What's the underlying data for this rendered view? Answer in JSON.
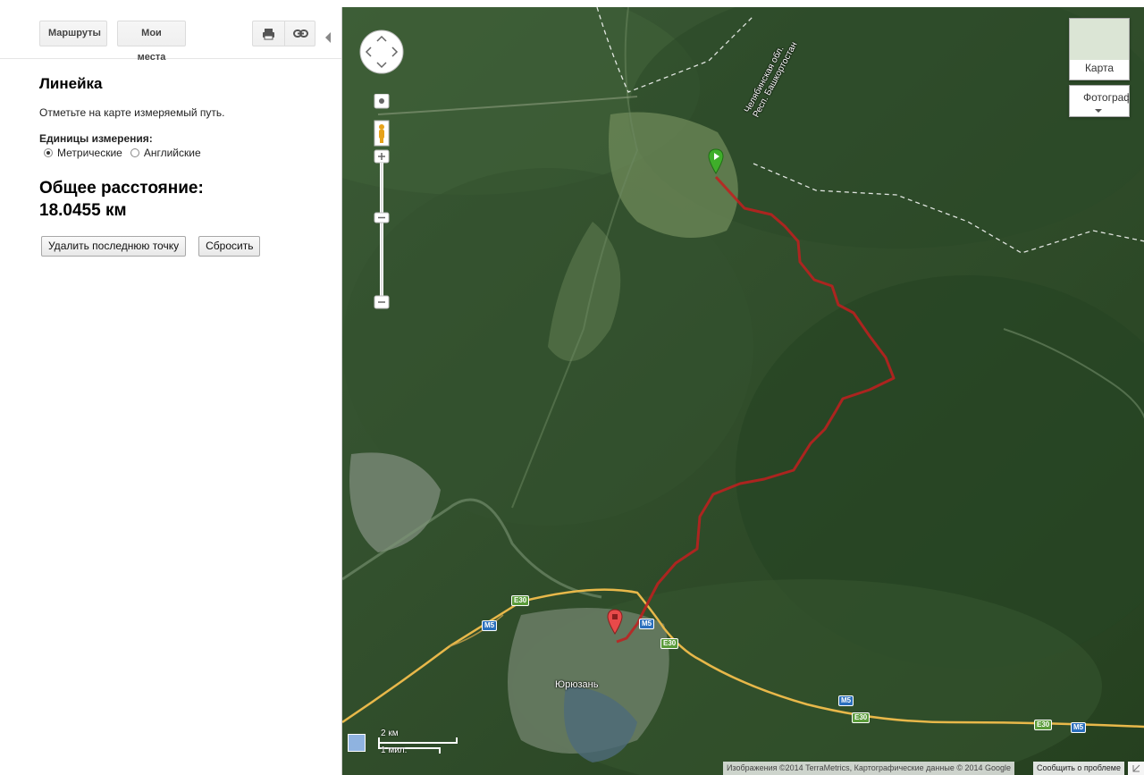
{
  "toolbar": {
    "routes_label": "Маршруты",
    "myplaces_label": "Мои места",
    "print_icon": "printer-icon",
    "link_icon": "link-icon",
    "collapse_icon": "collapse-left-icon"
  },
  "ruler": {
    "title": "Линейка",
    "hint": "Отметьте на карте измеряемый путь.",
    "units_label": "Единицы измерения:",
    "units": [
      {
        "label": "Метрические",
        "selected": true
      },
      {
        "label": "Английские",
        "selected": false
      }
    ],
    "total_label": "Общее расстояние:",
    "total_value": "18.0455 км",
    "delete_last_label": "Удалить последнюю точку",
    "reset_label": "Сбросить"
  },
  "map": {
    "map_type_label": "Карта",
    "photo_type_label": "Фотография",
    "border_label_1": "Челябинская обл.",
    "border_label_2": "Респ. Башкортостан",
    "town_label": "Юрюзань",
    "shields": {
      "m5": "M5",
      "e30": "E30"
    },
    "scale_km": "2 км",
    "scale_mi": "1 мил.",
    "attribution": "Изображения ©2014 TerraMetrics, Картографические данные © 2014 Google",
    "report_label": "Сообщить о проблеме",
    "route_color": "#c21e1e",
    "start_marker_color": "#3fae2a",
    "end_marker_color": "#e84a4a"
  }
}
